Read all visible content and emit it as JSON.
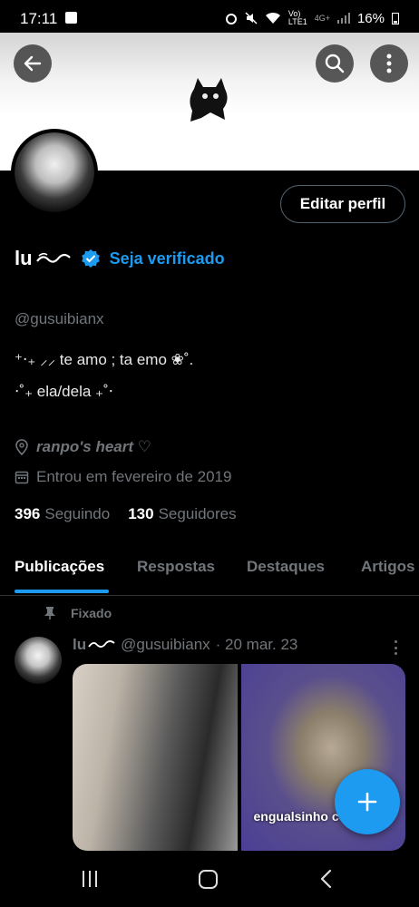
{
  "status_bar": {
    "time": "17:11",
    "carrier_top": "Vo)",
    "carrier_bottom": "LTE1",
    "network": "4G+",
    "battery": "16%"
  },
  "profile": {
    "display_name": "lu",
    "verify_cta": "Seja verificado",
    "handle": "@gusuibianx",
    "bio_line1": "⁺‧₊ ⸝⸝ te amo ; ta emo ❀˚.",
    "bio_line2": "⋅˚₊ ela/dela ₊˚⋅",
    "location": "ranpo's heart ♡",
    "joined": "Entrou em fevereiro de 2019",
    "following_count": "396",
    "following_label": "Seguindo",
    "followers_count": "130",
    "followers_label": "Seguidores",
    "edit_button": "Editar perfil"
  },
  "tabs": [
    {
      "label": "Publicações",
      "active": true
    },
    {
      "label": "Respostas",
      "active": false
    },
    {
      "label": "Destaques",
      "active": false
    },
    {
      "label": "Artigos",
      "active": false
    }
  ],
  "post": {
    "pinned_label": "Fixado",
    "author": "lu",
    "handle": "@gusuibianx",
    "date": "· 20 mar. 23",
    "media_caption": "engualsinho c"
  },
  "colors": {
    "accent": "#1d9bf0",
    "background": "#000000",
    "muted": "#71767b"
  },
  "icons": {
    "back": "arrow-left-icon",
    "search": "search-icon",
    "more": "more-vertical-icon",
    "verified": "verified-badge-icon",
    "location": "location-pin-icon",
    "calendar": "calendar-icon",
    "pin": "pin-icon",
    "compose": "plus-icon"
  }
}
